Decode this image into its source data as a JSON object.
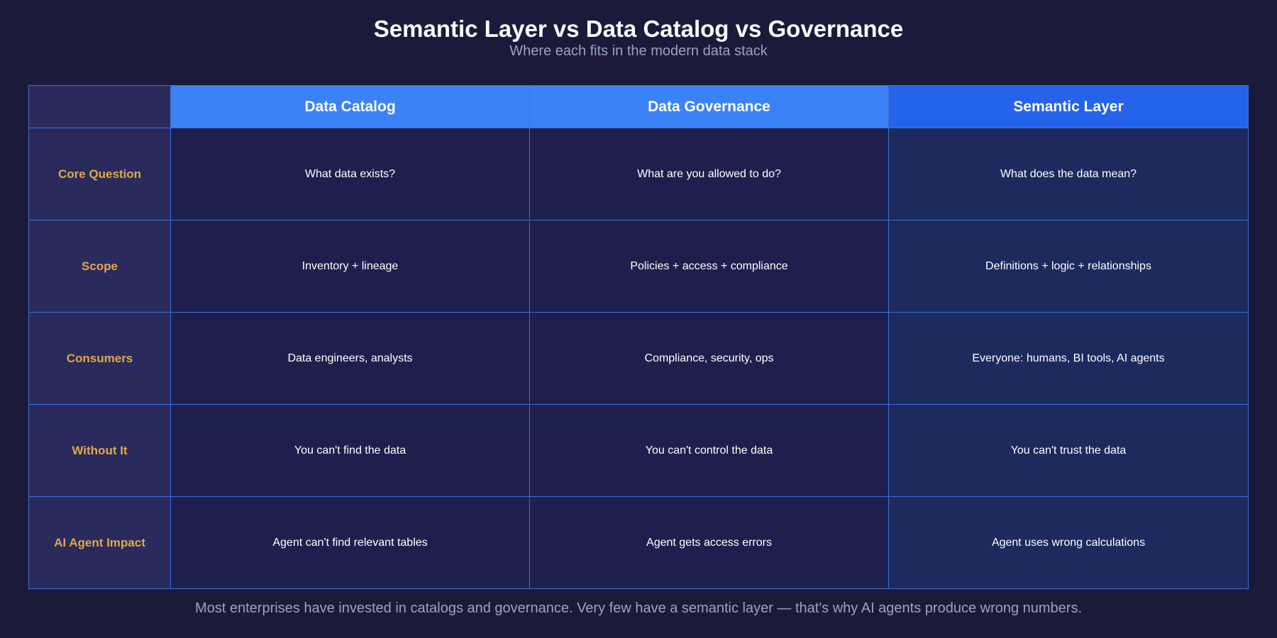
{
  "title": "Semantic Layer vs Data Catalog vs Governance",
  "subtitle": "Where each fits in the modern data stack",
  "table": {
    "headers": [
      "",
      "Data Catalog",
      "Data Governance",
      "Semantic Layer"
    ],
    "rows": [
      {
        "label": "Core Question",
        "cells": [
          "What data exists?",
          "What are you allowed to do?",
          "What does the data mean?"
        ]
      },
      {
        "label": "Scope",
        "cells": [
          "Inventory + lineage",
          "Policies + access + compliance",
          "Definitions + logic + relationships"
        ]
      },
      {
        "label": "Consumers",
        "cells": [
          "Data engineers, analysts",
          "Compliance, security, ops",
          "Everyone: humans, BI tools, AI agents"
        ]
      },
      {
        "label": "Without It",
        "cells": [
          "You can't find the data",
          "You can't control the data",
          "You can't trust the data"
        ]
      },
      {
        "label": "AI Agent Impact",
        "cells": [
          "Agent can't find relevant tables",
          "Agent gets access errors",
          "Agent uses wrong calculations"
        ]
      }
    ]
  },
  "footer": "Most enterprises have invested in catalogs and governance. Very few have a semantic layer — that's why AI agents produce wrong numbers.",
  "colors": {
    "background": "#1b1a3a",
    "header": "#3b82f6",
    "header_highlight": "#2563eb",
    "row_label": "#e0a84a",
    "border": "#3b6fd8"
  }
}
